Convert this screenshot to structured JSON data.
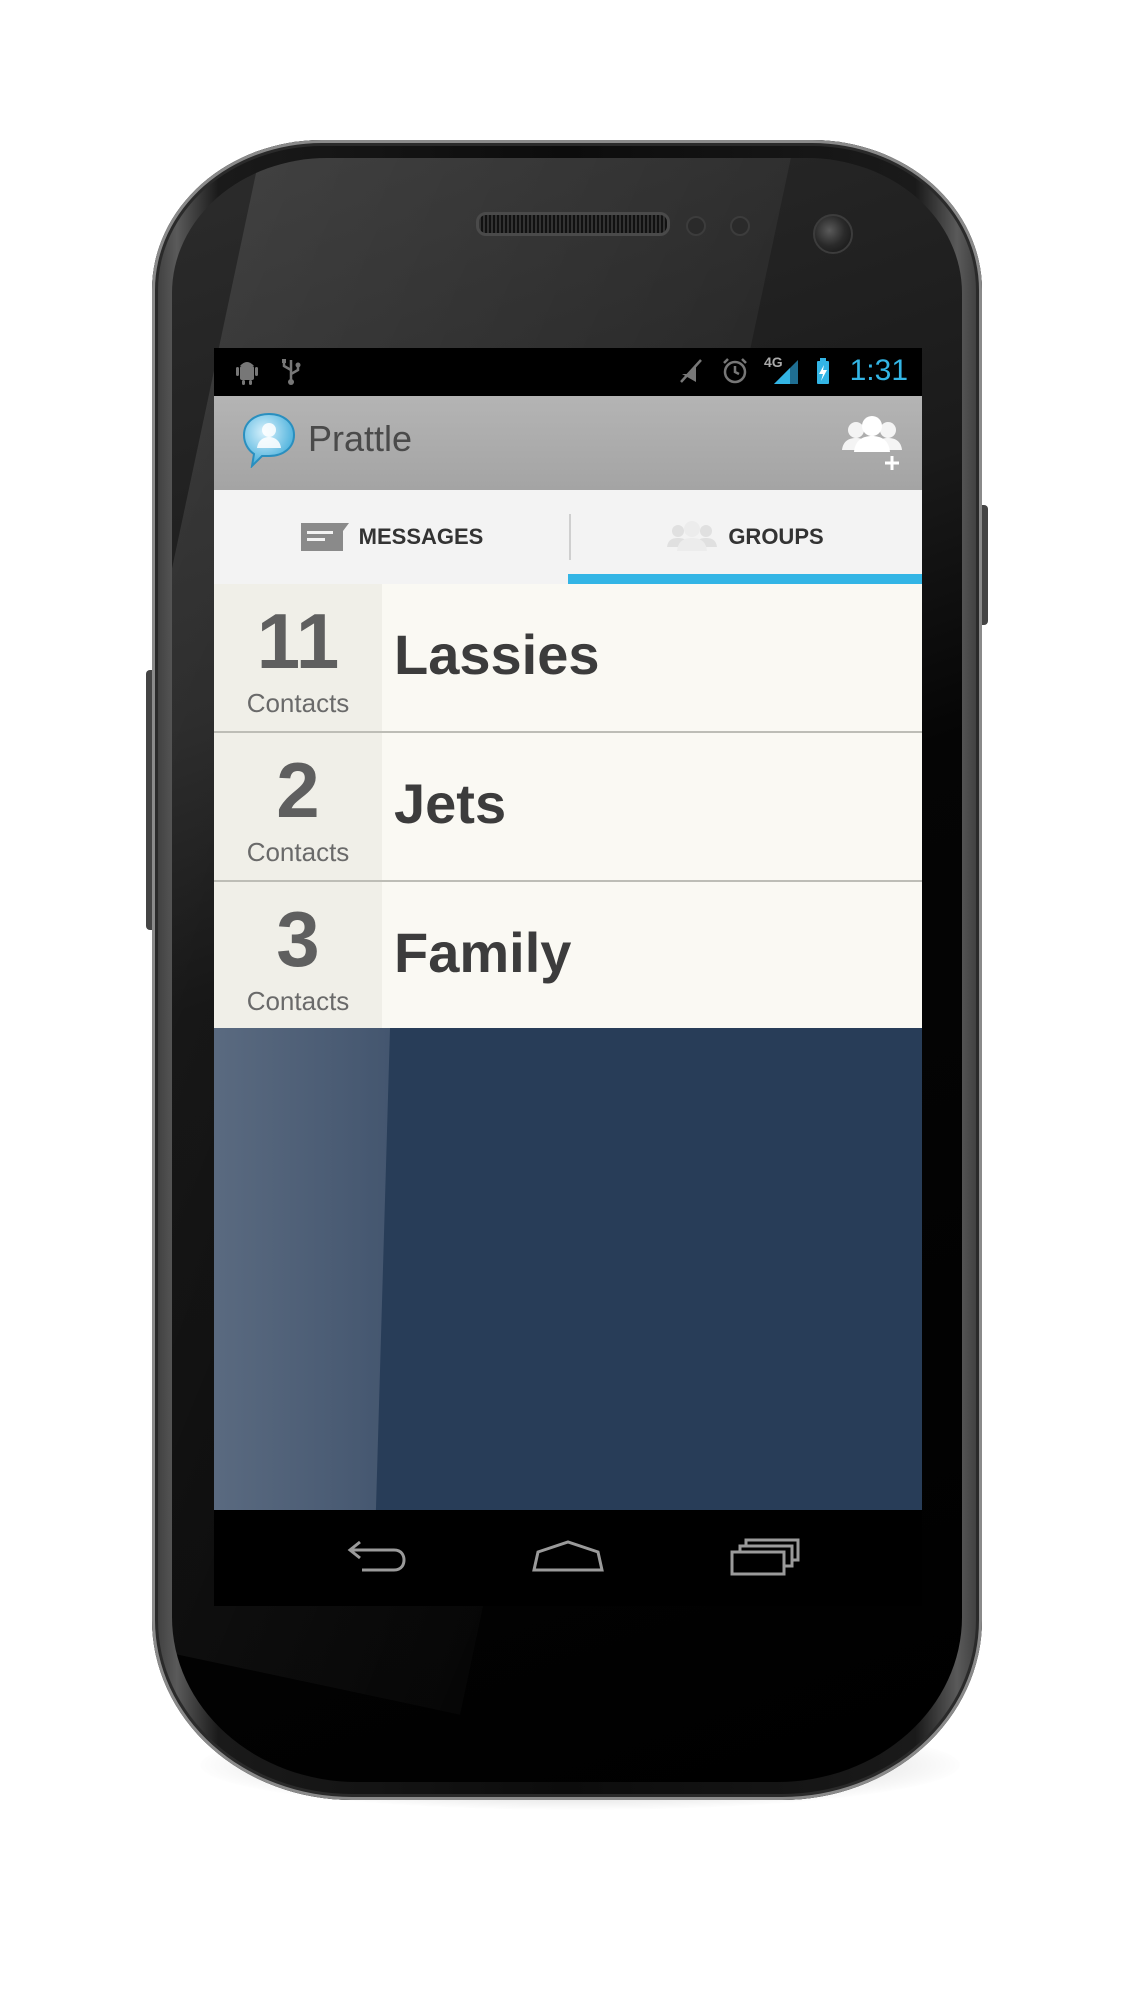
{
  "status_bar": {
    "time": "1:31",
    "network": "4G",
    "left_icons": [
      "android-debug-icon",
      "usb-icon"
    ],
    "right_icons": [
      "mute-icon",
      "alarm-icon",
      "signal-icon",
      "battery-icon"
    ]
  },
  "action_bar": {
    "app_title": "Prattle",
    "app_icon": "chat-bubble-icon",
    "action_icon": "add-group-icon"
  },
  "tabs": [
    {
      "label": "MESSAGES",
      "icon": "message-icon",
      "selected": false
    },
    {
      "label": "GROUPS",
      "icon": "group-icon",
      "selected": true
    }
  ],
  "groups": [
    {
      "count": "11",
      "count_label": "Contacts",
      "name": "Lassies"
    },
    {
      "count": "2",
      "count_label": "Contacts",
      "name": "Jets"
    },
    {
      "count": "3",
      "count_label": "Contacts",
      "name": "Family"
    }
  ],
  "nav_bar": {
    "buttons": [
      "back-icon",
      "home-icon",
      "recent-apps-icon"
    ]
  },
  "colors": {
    "accent": "#33b5e5",
    "action_bar": "#aaaaaa",
    "list_bg": "#faf9f3",
    "empty_bg": "#283d58"
  }
}
